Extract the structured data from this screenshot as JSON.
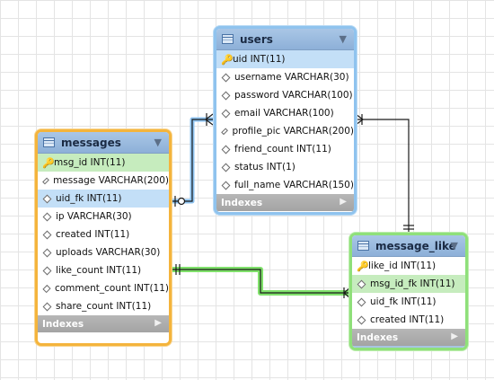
{
  "tables": {
    "users": {
      "title": "users",
      "columns": [
        {
          "text": "uid INT(11)",
          "icon": "key-icon"
        },
        {
          "text": "username VARCHAR(30)",
          "icon": "diamond-icon"
        },
        {
          "text": "password VARCHAR(100)",
          "icon": "diamond-icon"
        },
        {
          "text": "email VARCHAR(100)",
          "icon": "diamond-icon"
        },
        {
          "text": "profile_pic VARCHAR(200)",
          "icon": "diamond-icon"
        },
        {
          "text": "friend_count INT(11)",
          "icon": "diamond-icon"
        },
        {
          "text": "status INT(1)",
          "icon": "diamond-icon"
        },
        {
          "text": "full_name VARCHAR(150)",
          "icon": "diamond-icon"
        }
      ],
      "indexes_label": "Indexes"
    },
    "messages": {
      "title": "messages",
      "columns": [
        {
          "text": "msg_id INT(11)",
          "icon": "key-icon"
        },
        {
          "text": "message VARCHAR(200)",
          "icon": "diamond-icon"
        },
        {
          "text": "uid_fk INT(11)",
          "icon": "diamond-icon"
        },
        {
          "text": "ip VARCHAR(30)",
          "icon": "diamond-icon"
        },
        {
          "text": "created INT(11)",
          "icon": "diamond-icon"
        },
        {
          "text": "uploads VARCHAR(30)",
          "icon": "diamond-icon"
        },
        {
          "text": "like_count INT(11)",
          "icon": "diamond-icon"
        },
        {
          "text": "comment_count INT(11)",
          "icon": "diamond-icon"
        },
        {
          "text": "share_count INT(11)",
          "icon": "diamond-icon"
        }
      ],
      "indexes_label": "Indexes"
    },
    "message_like": {
      "title": "message_like",
      "columns": [
        {
          "text": "like_id INT(11)",
          "icon": "key-icon"
        },
        {
          "text": "msg_id_fk INT(11)",
          "icon": "diamond-icon"
        },
        {
          "text": "uid_fk INT(11)",
          "icon": "diamond-icon"
        },
        {
          "text": "created INT(11)",
          "icon": "diamond-icon"
        }
      ],
      "indexes_label": "Indexes"
    }
  },
  "colors": {
    "selected_blue": "#8fc3ee",
    "selected_orange": "#f4b43c",
    "selected_green": "#8fe07a",
    "highlight_green_row": "#c6ecbe",
    "highlight_blue_row": "#c3dff7",
    "relationship_blue": "#4a90d9",
    "relationship_green": "#4cd13a"
  }
}
